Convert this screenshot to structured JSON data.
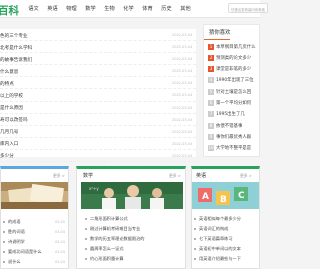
{
  "header": {
    "logo": "百科",
    "nav": [
      "语文",
      "英语",
      "物理",
      "数学",
      "生物",
      "化学",
      "体育",
      "历史",
      "其他"
    ],
    "search_placeholder": "仿佛出发奇装问你奇葩"
  },
  "main_list": [
    {
      "title": "色的三个专业",
      "date": "2022-03-04"
    },
    {
      "title": "北考是什么学科",
      "date": "2022-03-04"
    },
    {
      "title": "的故事告诉我们",
      "date": "2022-03-04"
    },
    {
      "title": "什么意思",
      "date": "2022-03-04"
    },
    {
      "title": "的特点",
      "date": "2022-03-04"
    },
    {
      "title": "以上的学校",
      "date": "2022-03-04"
    },
    {
      "title": "是什么原因",
      "date": "2022-03-04"
    },
    {
      "title": "寿可以改签吗",
      "date": "2022-03-04"
    },
    {
      "title": "几月几号",
      "date": "2022-03-04"
    },
    {
      "title": "库内入口",
      "date": "2022-03-04"
    },
    {
      "title": "多少分",
      "date": "2022-03-04"
    }
  ],
  "sidebar": {
    "title": "猜你喜欢",
    "items": [
      {
        "num": "1",
        "text": "本草纲目第几页什么"
      },
      {
        "num": "2",
        "text": "预测类的论文多少"
      },
      {
        "num": "3",
        "text": "课堂是非笔的多少"
      },
      {
        "num": "4",
        "text": "1990年出现了三位"
      },
      {
        "num": "5",
        "text": "针对土壤是怎么回"
      },
      {
        "num": "6",
        "text": "第一个平均分如何"
      },
      {
        "num": "7",
        "text": "1995出生了几"
      },
      {
        "num": "8",
        "text": "依偎不错基事"
      },
      {
        "num": "9",
        "text": "事你们最优秀人群"
      },
      {
        "num": "10",
        "text": "大学地不整平是是"
      }
    ]
  },
  "panels": {
    "left": {
      "more": "更多 >",
      "items": [
        {
          "text": "的成语",
          "date": "03-05"
        },
        {
          "text": "胜的词语",
          "date": "03-04"
        },
        {
          "text": "诗说明学",
          "date": "03-04"
        },
        {
          "text": "要成功词语是什么",
          "date": "03-04"
        },
        {
          "text": "说什么",
          "date": "03-04"
        }
      ]
    },
    "middle": {
      "title": "数学",
      "more": "更多 >",
      "items": [
        "二角形面积计算公式",
        "刚过计算机考研难目当专业",
        "数学的历五率理论数据限治的",
        "圆周率怎么一证式",
        "约心形面积量计算"
      ]
    },
    "right": {
      "title": "英语",
      "more": "更多 >",
      "items": [
        {
          "text": "英语相似每个最多少分",
          "date": "03-05"
        },
        {
          "text": "英语词汇的构成",
          "date": "03-04"
        },
        {
          "text": "七下英语篇章练习",
          "date": "03-04"
        },
        {
          "text": "英语初中单词以的文本",
          "date": "03-04"
        },
        {
          "text": "用英语介绍最些与一下",
          "date": "03-04"
        }
      ]
    }
  }
}
